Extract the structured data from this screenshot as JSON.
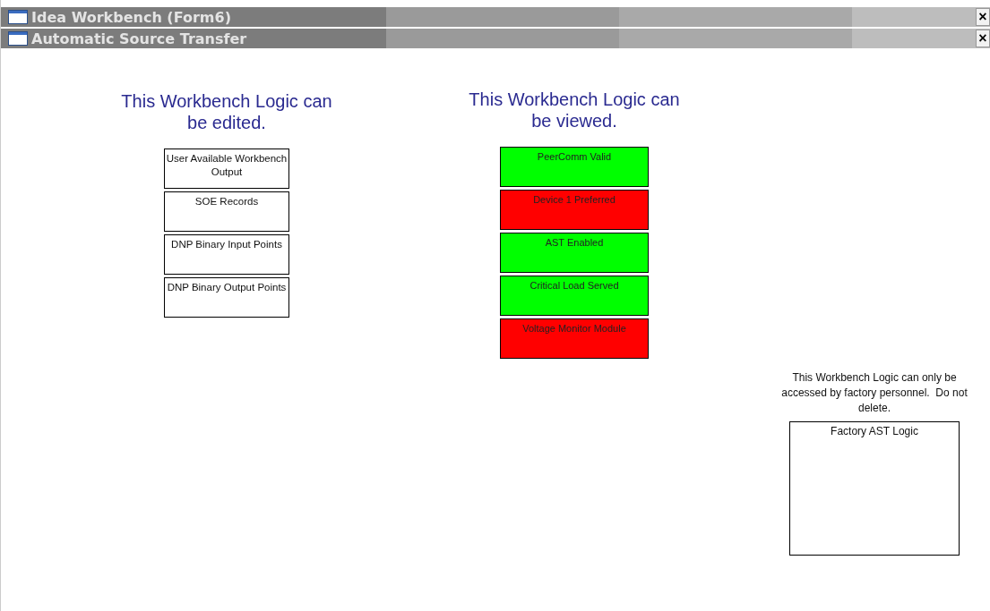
{
  "windows": [
    {
      "title": "Idea Workbench (Form6)",
      "close": "×"
    },
    {
      "title": "Automatic Source Transfer",
      "close": "×"
    }
  ],
  "editable": {
    "heading": "This Workbench Logic can be edited.",
    "blocks": [
      "User Available Workbench Output",
      "SOE Records",
      "DNP Binary Input Points",
      "DNP Binary Output Points"
    ]
  },
  "viewable": {
    "heading": "This Workbench Logic can be viewed.",
    "blocks": [
      {
        "label": "PeerComm Valid",
        "color": "#00ff00"
      },
      {
        "label": "Device 1 Preferred",
        "color": "#ff0000"
      },
      {
        "label": "AST Enabled",
        "color": "#00ff00"
      },
      {
        "label": "Critical Load Served",
        "color": "#00ff00"
      },
      {
        "label": "Voltage Monitor Module",
        "color": "#ff0000"
      }
    ]
  },
  "factory": {
    "note": "This Workbench Logic can only be accessed by factory personnel.  Do not delete.",
    "block": "Factory AST Logic"
  }
}
